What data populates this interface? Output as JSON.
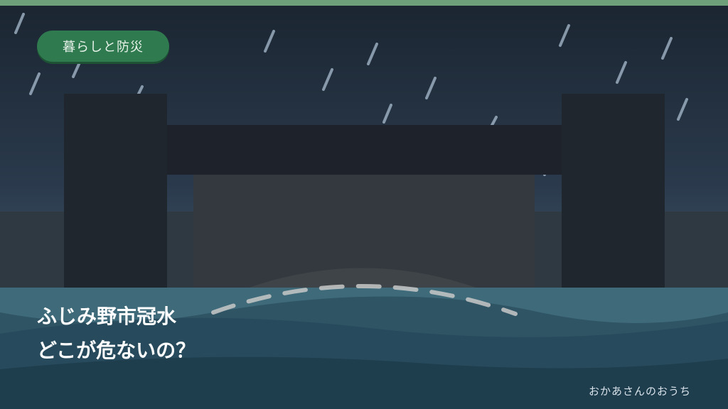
{
  "badge": {
    "label": "暮らしと防災"
  },
  "headline": {
    "line1": "ふじみ野市冠水",
    "line2": "どこが危ないの？"
  },
  "credit": "おかあさんのおうち",
  "colors": {
    "accent_stripe": "#6ea07a",
    "badge_bg": "#2f7a4f",
    "water": "#3e6a7a",
    "bridge": "#1e232b"
  },
  "icons": [
    "rain-streaks",
    "bridge-structure",
    "flood-water"
  ]
}
